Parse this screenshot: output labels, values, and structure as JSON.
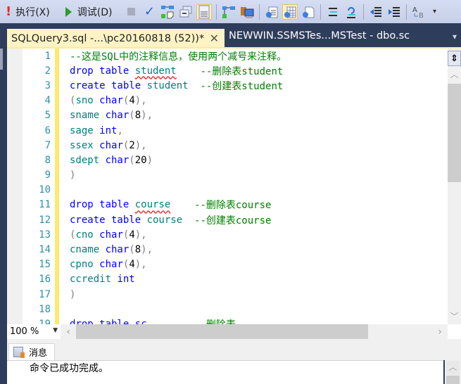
{
  "toolbar": {
    "execute_label": "执行(X)",
    "debug_label": "调试(D)",
    "icons": [
      "execute-icon",
      "debug-play-icon",
      "stop-icon",
      "parse-check-icon",
      "query-design-icon",
      "results-to-icon",
      "results-to-text-icon",
      "include-plan-icon",
      "client-stats-icon",
      "results-to-grid-icon",
      "results-to-file-icon",
      "comment-icon",
      "uncomment-icon",
      "decrease-indent-icon",
      "increase-indent-icon",
      "specify-values-icon",
      "overflow-icon"
    ]
  },
  "tabs": {
    "active": {
      "label": "SQLQuery3.sql -...\\pc20160818 (52))*",
      "close": "✕"
    },
    "inactive": {
      "label": "NEWWIN.SSMSTes...MSTest - dbo.sc"
    },
    "overflow": "▾"
  },
  "editor": {
    "lines": [
      {
        "n": "1",
        "tokens": [
          {
            "t": "--这是SQL中的注释信息，使用两个减号来注释。",
            "c": "cm"
          }
        ]
      },
      {
        "n": "2",
        "tokens": [
          {
            "t": "drop table ",
            "c": "kw"
          },
          {
            "t": "student",
            "c": "id squig"
          },
          {
            "t": "    --删除表student",
            "c": "cm"
          }
        ]
      },
      {
        "n": "3",
        "tokens": [
          {
            "t": "create table ",
            "c": "kw"
          },
          {
            "t": "student",
            "c": "id"
          },
          {
            "t": "  --创建表student",
            "c": "cm"
          }
        ]
      },
      {
        "n": "4",
        "tokens": [
          {
            "t": "(",
            "c": "op"
          },
          {
            "t": "sno ",
            "c": "id"
          },
          {
            "t": "char",
            "c": "kw"
          },
          {
            "t": "(",
            "c": "op"
          },
          {
            "t": "4",
            "c": "num"
          },
          {
            "t": "),",
            "c": "op"
          }
        ]
      },
      {
        "n": "5",
        "tokens": [
          {
            "t": "sname ",
            "c": "id"
          },
          {
            "t": "char",
            "c": "kw"
          },
          {
            "t": "(",
            "c": "op"
          },
          {
            "t": "8",
            "c": "num"
          },
          {
            "t": "),",
            "c": "op"
          }
        ]
      },
      {
        "n": "6",
        "tokens": [
          {
            "t": "sage ",
            "c": "id"
          },
          {
            "t": "int",
            "c": "kw"
          },
          {
            "t": ",",
            "c": "op"
          }
        ]
      },
      {
        "n": "7",
        "tokens": [
          {
            "t": "ssex ",
            "c": "id"
          },
          {
            "t": "char",
            "c": "kw"
          },
          {
            "t": "(",
            "c": "op"
          },
          {
            "t": "2",
            "c": "num"
          },
          {
            "t": "),",
            "c": "op"
          }
        ]
      },
      {
        "n": "8",
        "tokens": [
          {
            "t": "sdept ",
            "c": "id"
          },
          {
            "t": "char",
            "c": "kw"
          },
          {
            "t": "(",
            "c": "op"
          },
          {
            "t": "20",
            "c": "num"
          },
          {
            "t": ")",
            "c": "op"
          }
        ]
      },
      {
        "n": "9",
        "tokens": [
          {
            "t": ")",
            "c": "op"
          }
        ]
      },
      {
        "n": "10",
        "tokens": []
      },
      {
        "n": "11",
        "tokens": [
          {
            "t": "drop table ",
            "c": "kw"
          },
          {
            "t": "course",
            "c": "id squig"
          },
          {
            "t": "    --删除表course",
            "c": "cm"
          }
        ]
      },
      {
        "n": "12",
        "tokens": [
          {
            "t": "create table ",
            "c": "kw"
          },
          {
            "t": "course",
            "c": "id"
          },
          {
            "t": "  --创建表course",
            "c": "cm"
          }
        ]
      },
      {
        "n": "13",
        "tokens": [
          {
            "t": "(",
            "c": "op"
          },
          {
            "t": "cno ",
            "c": "id"
          },
          {
            "t": "char",
            "c": "kw"
          },
          {
            "t": "(",
            "c": "op"
          },
          {
            "t": "4",
            "c": "num"
          },
          {
            "t": "),",
            "c": "op"
          }
        ]
      },
      {
        "n": "14",
        "tokens": [
          {
            "t": "cname ",
            "c": "id"
          },
          {
            "t": "char",
            "c": "kw"
          },
          {
            "t": "(",
            "c": "op"
          },
          {
            "t": "8",
            "c": "num"
          },
          {
            "t": "),",
            "c": "op"
          }
        ]
      },
      {
        "n": "15",
        "tokens": [
          {
            "t": "cpno ",
            "c": "id"
          },
          {
            "t": "char",
            "c": "kw"
          },
          {
            "t": "(",
            "c": "op"
          },
          {
            "t": "4",
            "c": "num"
          },
          {
            "t": "),",
            "c": "op"
          }
        ]
      },
      {
        "n": "16",
        "tokens": [
          {
            "t": "ccredit ",
            "c": "id"
          },
          {
            "t": "int",
            "c": "kw"
          }
        ]
      },
      {
        "n": "17",
        "tokens": [
          {
            "t": ")",
            "c": "op"
          }
        ]
      },
      {
        "n": "18",
        "tokens": []
      },
      {
        "n": "19",
        "tokens": [
          {
            "t": "drop table sc",
            "c": "kw"
          },
          {
            "t": "        --删除表",
            "c": "cm"
          }
        ]
      }
    ]
  },
  "zoom": {
    "value": "100 %"
  },
  "scroll": {
    "vertical_position": 0.0,
    "horizontal_position": 0.0
  },
  "results": {
    "tab_label": "消息",
    "message": "命令已成功完成。"
  },
  "colors": {
    "keyword": "#0000ff",
    "identifier": "#008080",
    "comment": "#008000",
    "line_number": "#2b91af",
    "tab_active_bg": "#fff2c4",
    "change_bar": "#fde96b"
  }
}
